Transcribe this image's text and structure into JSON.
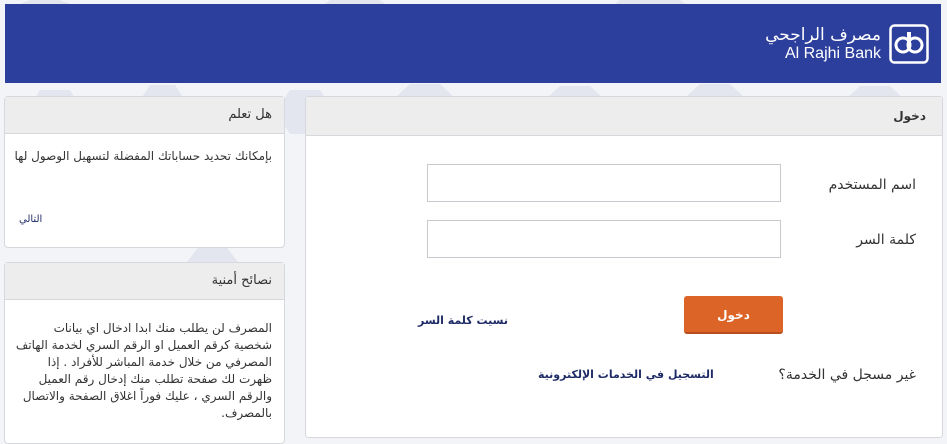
{
  "header": {
    "logo_ar": "مصرف الراجحي",
    "logo_en": "Al Rajhi Bank",
    "logo_icon": "al-rajhi-logo-icon",
    "bg_color": "#2c3f9c"
  },
  "login": {
    "title": "دخول",
    "username_label": "اسم المستخدم",
    "username_value": "",
    "password_label": "كلمة السر",
    "password_value": "",
    "submit_label": "دخول",
    "forgot_label": "نسيت كلمة السر",
    "not_registered": "غير مسجل في الخدمة؟",
    "register_label": "التسجيل في الخدمات الإلكترونية",
    "accent_color": "#dd6427"
  },
  "did_you_know": {
    "title": "هل تعلم",
    "text": "بإمكانك تحديد حساباتك المفضلة لتسهيل الوصول لها",
    "next_label": "التالي"
  },
  "security_tips": {
    "title": "نصائح أمنية",
    "text": "المصرف لن يطلب منك ابدا ادخال اي بيانات شخصية كرقم العميل او الرقم السري لخدمة الهاتف المصرفي من خلال خدمة المباشر للأفراد . إذا ظهرت لك صفحة تطلب منك إدخال رقم العميل والرقم السري ، عليك فوراً اغلاق الصفحة والاتصال بالمصرف."
  }
}
